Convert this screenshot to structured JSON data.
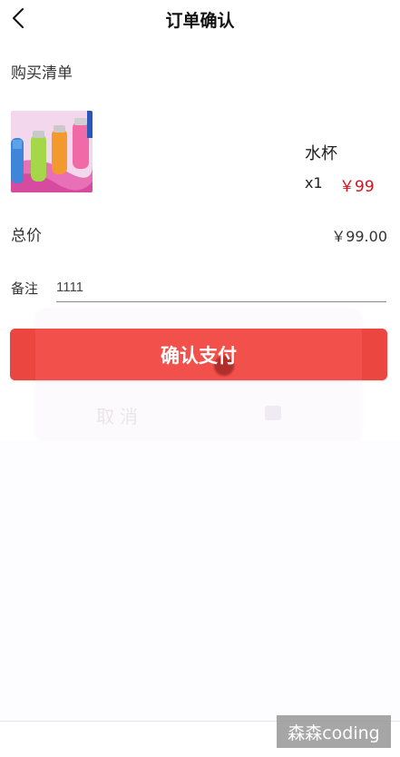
{
  "header": {
    "title": "订单确认",
    "back_icon": "chevron-left-icon"
  },
  "order": {
    "section_label": "购买清单",
    "product": {
      "name": "水杯",
      "quantity": "x1",
      "price": "￥99",
      "image_icon": "cups-product-photo"
    },
    "total_label": "总价",
    "total_value": "￥99.00",
    "remark_label": "备注",
    "remark_value": "1111"
  },
  "modal": {
    "cancel_label": "取消"
  },
  "actions": {
    "pay_label": "确认支付"
  },
  "watermark": "森森coding",
  "colors": {
    "accent": "#f2504a",
    "price": "#d0121b"
  }
}
